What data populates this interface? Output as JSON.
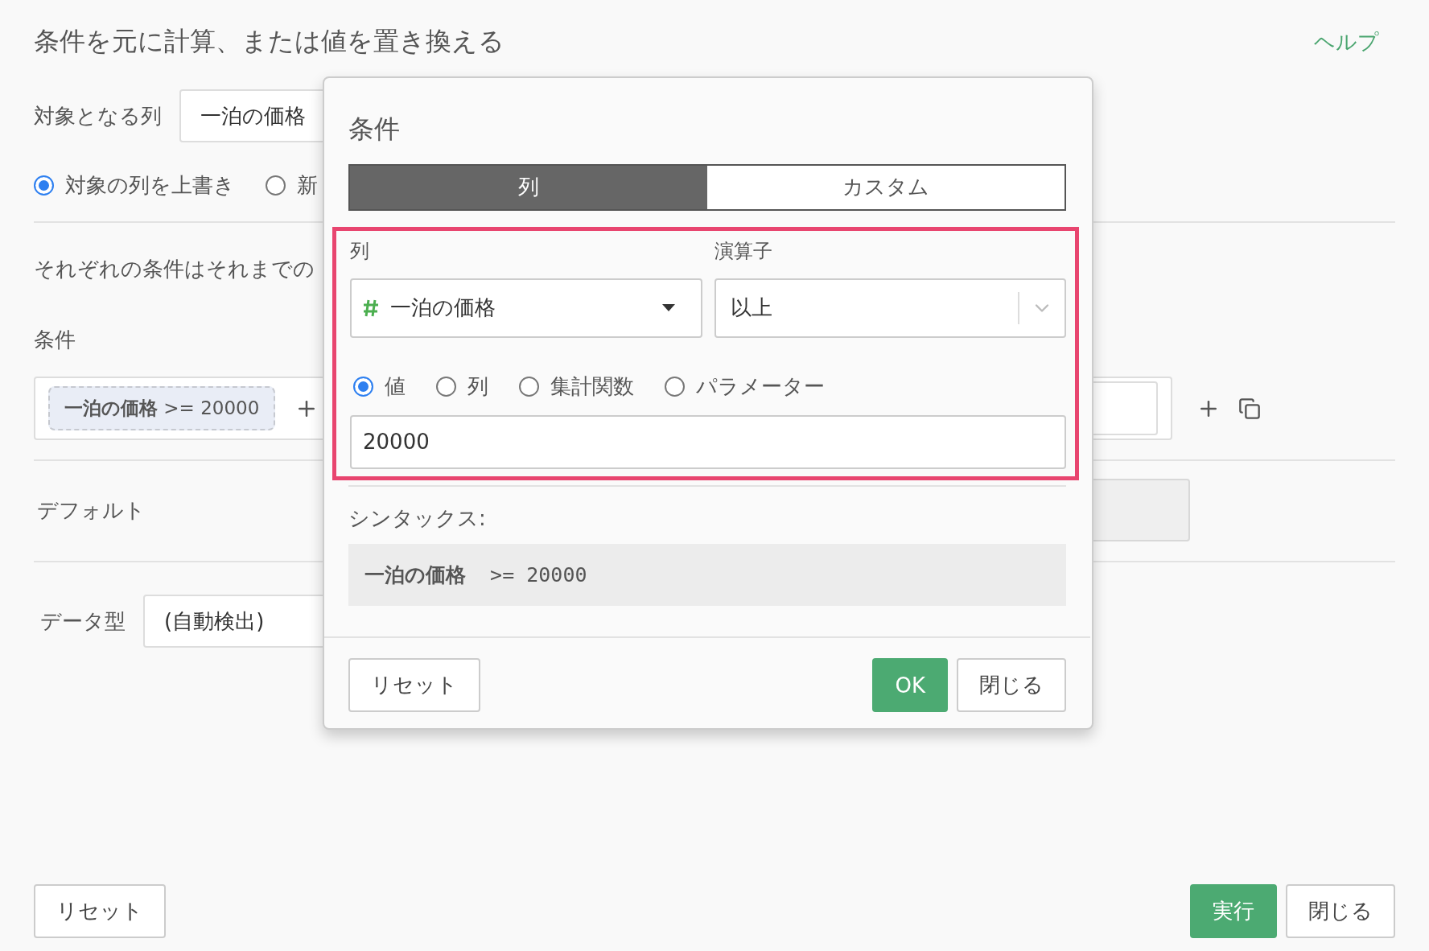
{
  "title": "条件を元に計算、または値を置き換える",
  "help_link": "ヘルプ",
  "target_column": {
    "label": "対象となる列",
    "value": "一泊の価格"
  },
  "write_mode": [
    {
      "label": "対象の列を上書き",
      "selected": true
    },
    {
      "label": "新",
      "selected": false
    }
  ],
  "description": "それぞれの条件はそれまでの",
  "conditions": {
    "label": "条件",
    "chips": [
      "**一泊の価格** >= 20000"
    ]
  },
  "default": {
    "label": "デフォルト"
  },
  "data_type": {
    "label": "データ型",
    "value": "(自動検出)"
  },
  "buttons": [
    {
      "label": "リセット",
      "kind": "secondary"
    },
    {
      "label": "実行",
      "kind": "primary"
    },
    {
      "label": "閉じる",
      "kind": "secondary"
    }
  ],
  "popover": {
    "title": "条件",
    "tabs": [
      {
        "label": "列",
        "selected": true
      },
      {
        "label": "カスタム",
        "selected": false
      }
    ],
    "highlighted": true,
    "column_label": "列",
    "column_value": "一泊の価格",
    "operator_label": "演算子",
    "operator_value": "以上",
    "value_types": [
      {
        "label": "値",
        "selected": true
      },
      {
        "label": "列",
        "selected": false
      },
      {
        "label": "集計関数",
        "selected": false
      },
      {
        "label": "パラメーター",
        "selected": false
      }
    ],
    "value": "20000",
    "syntax_label": "シンタックス:",
    "syntax": "**一泊の価格**  >= 20000",
    "buttons": [
      {
        "label": "リセット",
        "kind": "secondary"
      },
      {
        "label": "OK",
        "kind": "primary"
      },
      {
        "label": "閉じる",
        "kind": "secondary"
      }
    ]
  }
}
